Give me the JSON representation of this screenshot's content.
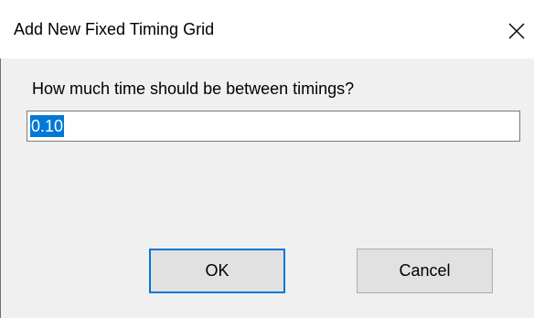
{
  "window": {
    "title": "Add New Fixed Timing Grid",
    "close_icon": "close-icon"
  },
  "dialog": {
    "prompt": "How much time should be between timings?",
    "input_value": "0.10",
    "input_selected": true,
    "ok_label": "OK",
    "cancel_label": "Cancel",
    "accent_color": "#0078d7"
  }
}
